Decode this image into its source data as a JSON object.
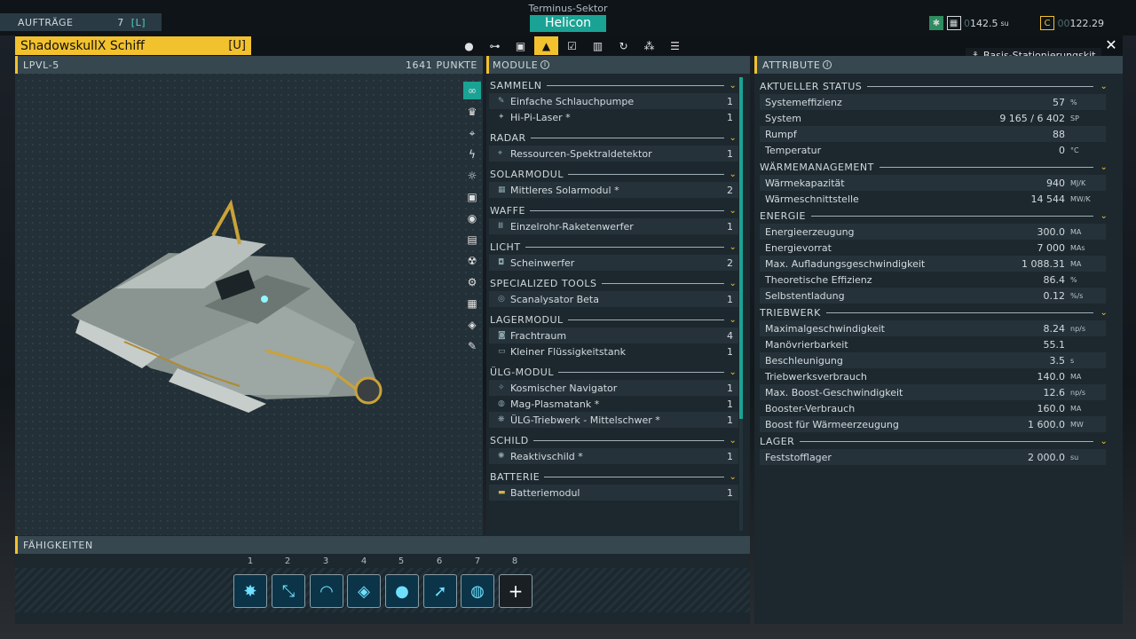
{
  "hud": {
    "orders_label": "AUFTRÄGE",
    "orders_count": "7",
    "orders_key": "[L]",
    "sector": "Terminus-Sektor",
    "station": "Helicon",
    "units": {
      "prefix": "0",
      "value": "142.5",
      "unit": "su"
    },
    "credits": {
      "prefix": "00",
      "value": "122.29"
    }
  },
  "window": {
    "title": "ShadowskullX Schiff",
    "title_key": "[U]",
    "tabs": [
      "person-icon",
      "network-icon",
      "cargo-icon",
      "ship-icon",
      "checklist-icon",
      "map-icon",
      "history-icon",
      "crew-icon",
      "log-icon"
    ],
    "active_tab": 3,
    "base_kit": "Basis-Stationierungskit"
  },
  "left": {
    "class": "LPVL-5",
    "points": "1641 PUNKTE",
    "filters": [
      "infinity-icon",
      "trophy-icon",
      "satellite-icon",
      "lightning-icon",
      "solar-icon",
      "weapon-icon",
      "light-icon",
      "tools-icon",
      "hazard-icon",
      "gear-icon",
      "storage-icon",
      "shield-icon",
      "battery-icon"
    ]
  },
  "modules": {
    "title": "MODULE",
    "categories": [
      {
        "name": "SAMMELN",
        "items": [
          {
            "name": "Einfache Schlauchpumpe",
            "qty": "1"
          },
          {
            "name": "Hi-Pi-Laser *",
            "qty": "1"
          }
        ]
      },
      {
        "name": "RADAR",
        "items": [
          {
            "name": "Ressourcen-Spektraldetektor",
            "qty": "1"
          }
        ]
      },
      {
        "name": "SOLARMODUL",
        "items": [
          {
            "name": "Mittleres Solarmodul *",
            "qty": "2"
          }
        ]
      },
      {
        "name": "WAFFE",
        "items": [
          {
            "name": "Einzelrohr-Raketenwerfer",
            "qty": "1"
          }
        ]
      },
      {
        "name": "LICHT",
        "items": [
          {
            "name": "Scheinwerfer",
            "qty": "2"
          }
        ]
      },
      {
        "name": "SPECIALIZED TOOLS",
        "items": [
          {
            "name": "Scanalysator Beta",
            "qty": "1"
          }
        ]
      },
      {
        "name": "LAGERMODUL",
        "items": [
          {
            "name": "Frachtraum",
            "qty": "4"
          },
          {
            "name": "Kleiner Flüssigkeitstank",
            "qty": "1"
          }
        ]
      },
      {
        "name": "ÜLG-MODUL",
        "items": [
          {
            "name": "Kosmischer Navigator",
            "qty": "1"
          },
          {
            "name": "Mag-Plasmatank *",
            "qty": "1"
          },
          {
            "name": "ÜLG-Triebwerk - Mittelschwer *",
            "qty": "1"
          }
        ]
      },
      {
        "name": "SCHILD",
        "items": [
          {
            "name": "Reaktivschild *",
            "qty": "1"
          }
        ]
      },
      {
        "name": "BATTERIE",
        "items": [
          {
            "name": "Batteriemodul",
            "qty": "1"
          }
        ]
      }
    ]
  },
  "attributes": {
    "title": "ATTRIBUTE",
    "sections": [
      {
        "name": "AKTUELLER STATUS",
        "rows": [
          {
            "label": "Systemeffizienz",
            "value": "57",
            "unit": "%"
          },
          {
            "label": "System",
            "value": "9 165 / 6 402",
            "unit": "SP"
          },
          {
            "label": "Rumpf",
            "value": "88",
            "unit": ""
          },
          {
            "label": "Temperatur",
            "value": "0",
            "unit": "°C"
          }
        ]
      },
      {
        "name": "WÄRMEMANAGEMENT",
        "rows": [
          {
            "label": "Wärmekapazität",
            "value": "940",
            "unit": "MJ/K"
          },
          {
            "label": "Wärmeschnittstelle",
            "value": "14 544",
            "unit": "MW/K"
          }
        ]
      },
      {
        "name": "ENERGIE",
        "rows": [
          {
            "label": "Energieerzeugung",
            "value": "300.0",
            "unit": "MA"
          },
          {
            "label": "Energievorrat",
            "value": "7 000",
            "unit": "MAs"
          },
          {
            "label": "Max. Aufladungsgeschwindigkeit",
            "value": "1 088.31",
            "unit": "MA"
          },
          {
            "label": "Theoretische Effizienz",
            "value": "86.4",
            "unit": "%"
          },
          {
            "label": "Selbstentladung",
            "value": "0.12",
            "unit": "%/s"
          }
        ]
      },
      {
        "name": "TRIEBWERK",
        "rows": [
          {
            "label": "Maximalgeschwindigkeit",
            "value": "8.24",
            "unit": "np/s"
          },
          {
            "label": "Manövrierbarkeit",
            "value": "55.1",
            "unit": ""
          },
          {
            "label": "Beschleunigung",
            "value": "3.5",
            "unit": "s"
          },
          {
            "label": "Triebwerksverbrauch",
            "value": "140.0",
            "unit": "MA"
          },
          {
            "label": "Max. Boost-Geschwindigkeit",
            "value": "12.6",
            "unit": "np/s"
          },
          {
            "label": "Booster-Verbrauch",
            "value": "160.0",
            "unit": "MA"
          },
          {
            "label": "Boost für Wärmeerzeugung",
            "value": "1 600.0",
            "unit": "MW"
          }
        ]
      },
      {
        "name": "LAGER",
        "rows": [
          {
            "label": "Feststofflager",
            "value": "2 000.0",
            "unit": "su"
          }
        ]
      }
    ]
  },
  "abilities": {
    "title": "FÄHIGKEITEN",
    "slots": [
      {
        "num": "1",
        "icon": "ability-burst-icon"
      },
      {
        "num": "2",
        "icon": "ability-drill-icon"
      },
      {
        "num": "3",
        "icon": "ability-scan-icon"
      },
      {
        "num": "4",
        "icon": "ability-shield-icon"
      },
      {
        "num": "5",
        "icon": "ability-drop-icon"
      },
      {
        "num": "6",
        "icon": "ability-boost-icon"
      },
      {
        "num": "7",
        "icon": "ability-orbit-icon"
      },
      {
        "num": "8",
        "icon": "add-icon"
      }
    ]
  }
}
